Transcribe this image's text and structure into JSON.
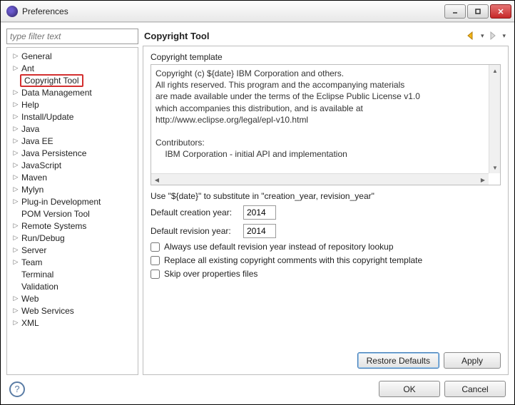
{
  "window": {
    "title": "Preferences"
  },
  "filter": {
    "placeholder": "type filter text"
  },
  "tree": {
    "items": [
      {
        "label": "General",
        "exp": true
      },
      {
        "label": "Ant",
        "exp": true
      },
      {
        "label": "Copyright Tool",
        "exp": false,
        "hl": true
      },
      {
        "label": "Data Management",
        "exp": true
      },
      {
        "label": "Help",
        "exp": true
      },
      {
        "label": "Install/Update",
        "exp": true
      },
      {
        "label": "Java",
        "exp": true
      },
      {
        "label": "Java EE",
        "exp": true
      },
      {
        "label": "Java Persistence",
        "exp": true
      },
      {
        "label": "JavaScript",
        "exp": true
      },
      {
        "label": "Maven",
        "exp": true
      },
      {
        "label": "Mylyn",
        "exp": true
      },
      {
        "label": "Plug-in Development",
        "exp": true
      },
      {
        "label": "POM Version Tool",
        "exp": false
      },
      {
        "label": "Remote Systems",
        "exp": true
      },
      {
        "label": "Run/Debug",
        "exp": true
      },
      {
        "label": "Server",
        "exp": true
      },
      {
        "label": "Team",
        "exp": true
      },
      {
        "label": "Terminal",
        "exp": false
      },
      {
        "label": "Validation",
        "exp": false
      },
      {
        "label": "Web",
        "exp": true
      },
      {
        "label": "Web Services",
        "exp": true
      },
      {
        "label": "XML",
        "exp": true
      }
    ]
  },
  "page": {
    "title": "Copyright Tool",
    "template_label": "Copyright template",
    "template_text": "Copyright (c) ${date} IBM Corporation and others.\nAll rights reserved. This program and the accompanying materials\nare made available under the terms of the Eclipse Public License v1.0\nwhich accompanies this distribution, and is available at\nhttp://www.eclipse.org/legal/epl-v10.html\n\nContributors:\n    IBM Corporation - initial API and implementation",
    "hint": "Use \"${date}\" to substitute in \"creation_year, revision_year\"",
    "creation_label": "Default creation year:",
    "creation_value": "2014",
    "revision_label": "Default revision year:",
    "revision_value": "2014",
    "chk_repo": "Always use default revision year instead of repository lookup",
    "chk_replace": "Replace all existing copyright comments with this copyright template",
    "chk_skip": "Skip over properties files",
    "restore": "Restore Defaults",
    "apply": "Apply"
  },
  "footer": {
    "ok": "OK",
    "cancel": "Cancel"
  }
}
